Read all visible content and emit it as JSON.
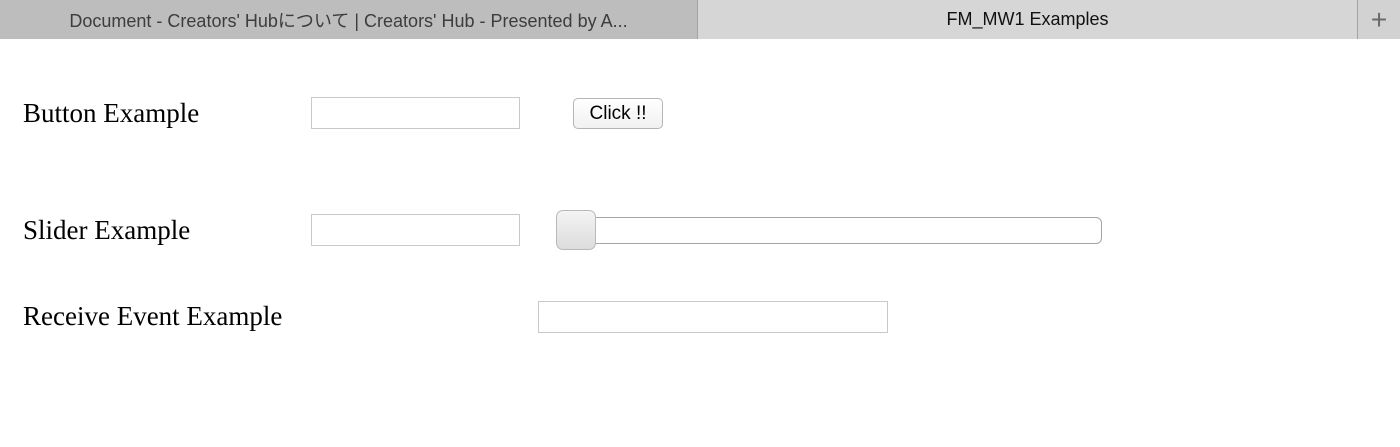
{
  "browser": {
    "tabs": [
      {
        "title": "Document - Creators' Hubについて | Creators' Hub - Presented by A...",
        "active": false
      },
      {
        "title": "FM_MW1 Examples",
        "active": true
      }
    ],
    "new_tab_label": "+"
  },
  "page": {
    "button_example": {
      "label": "Button Example",
      "input_value": "",
      "button_label": "Click !!"
    },
    "slider_example": {
      "label": "Slider Example",
      "input_value": "",
      "slider_value": 0
    },
    "receive_event_example": {
      "label": "Receive Event Example",
      "input_value": ""
    }
  }
}
